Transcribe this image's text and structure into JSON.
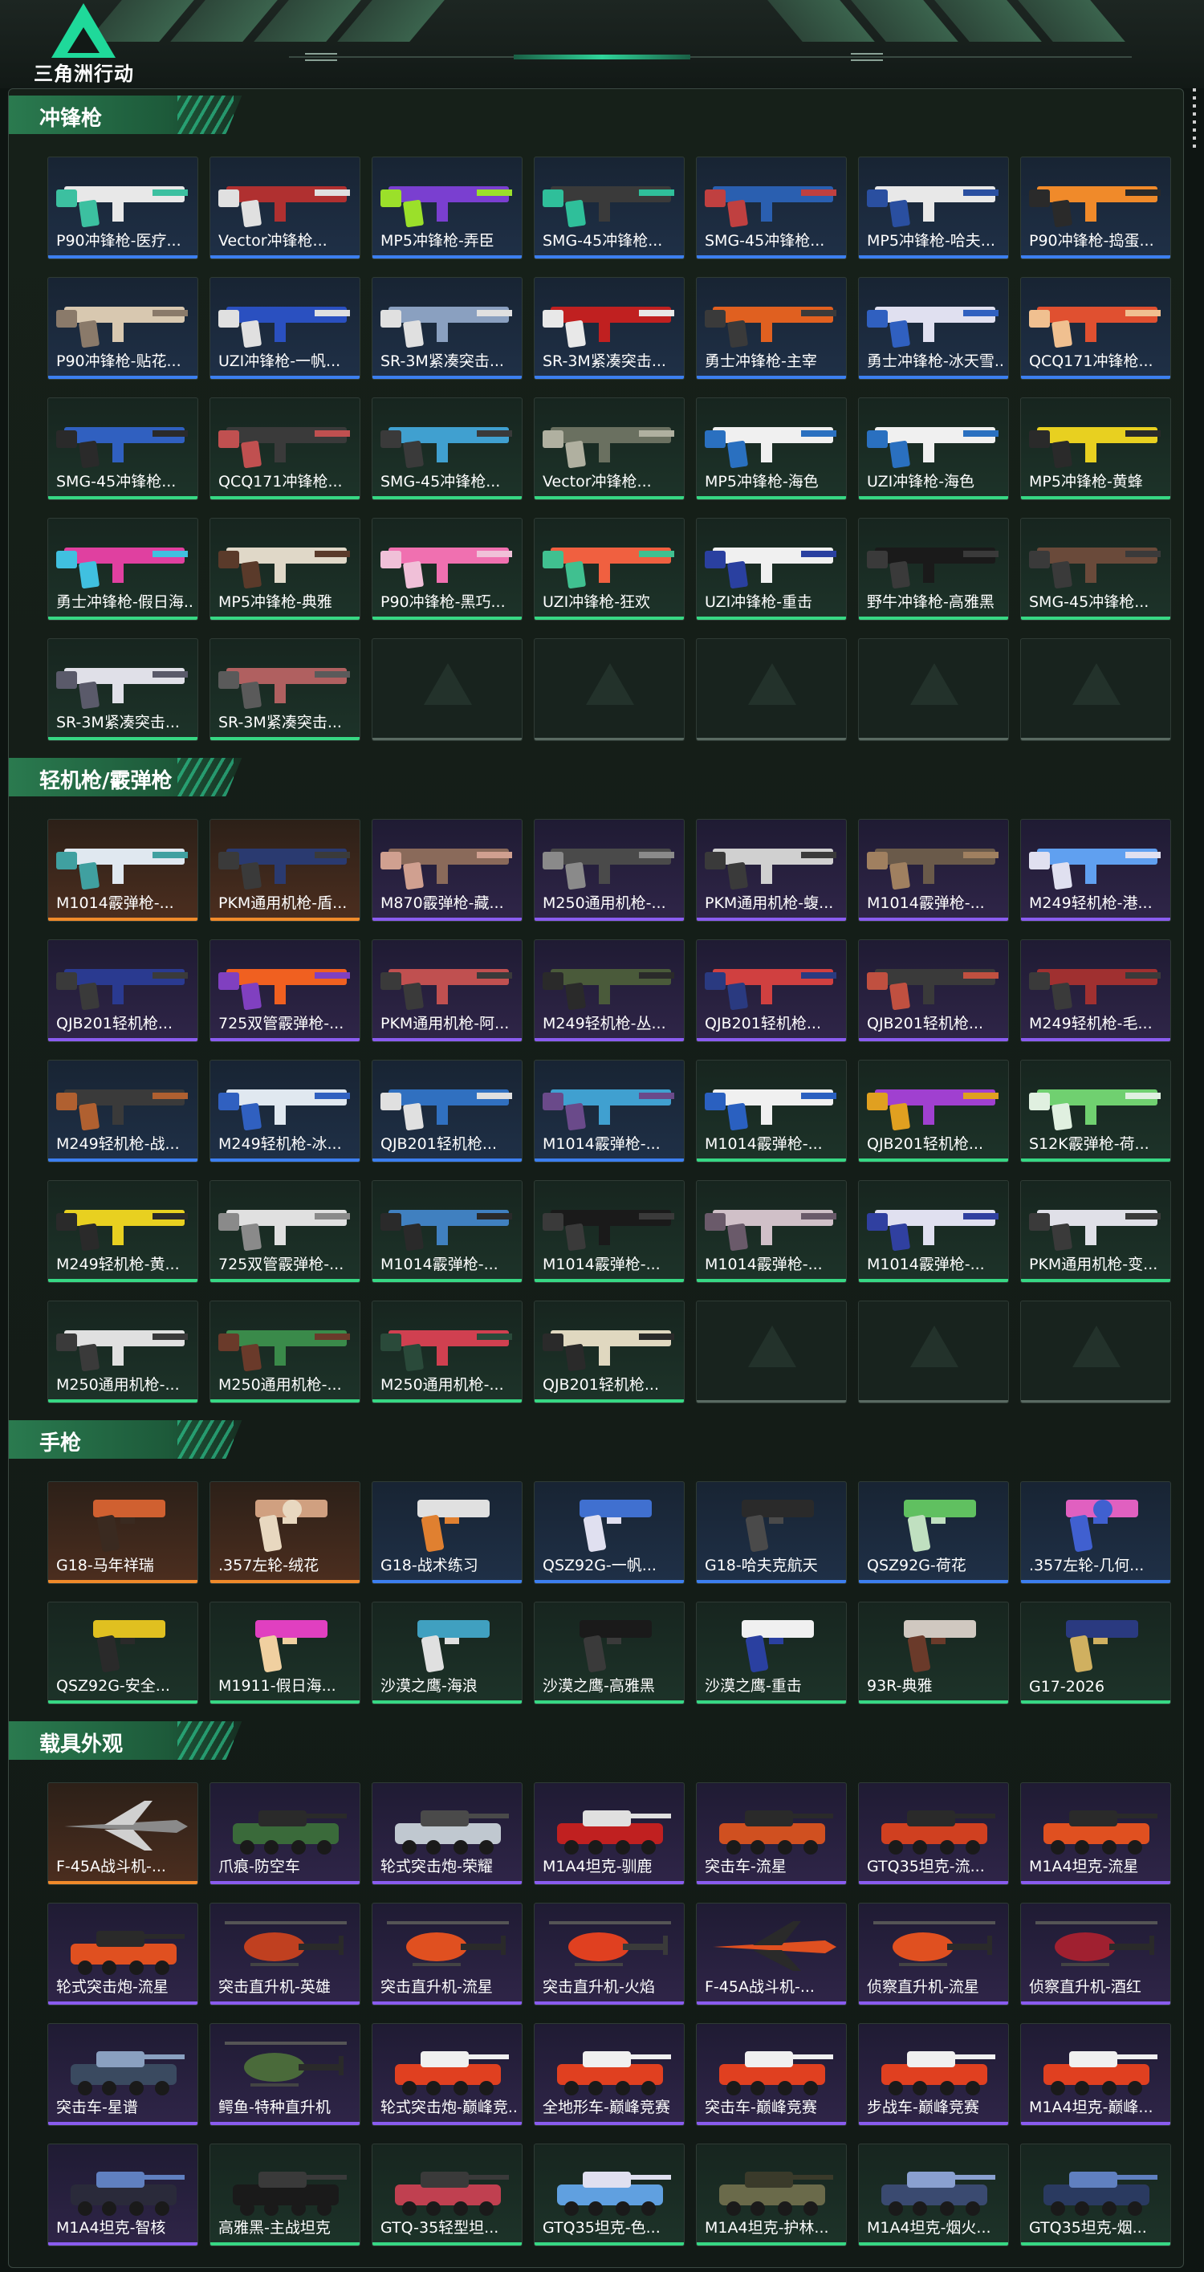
{
  "header": {
    "logo_text": "三角洲行动"
  },
  "colors": {
    "gold": "#f08a2a",
    "purple": "#8a5cf0",
    "blue": "#3c7ff0",
    "green": "#37d884",
    "accent": "#2fd49a"
  },
  "sections": [
    {
      "title": "冲锋枪",
      "items": [
        {
          "label": "P90冲锋枪-医疗...",
          "rarity": "blue",
          "icon": "smg-icon",
          "c1": "#e8e8e8",
          "c2": "#3cc0a0"
        },
        {
          "label": "Vector冲锋枪...",
          "rarity": "blue",
          "icon": "smg-icon",
          "c1": "#b03030",
          "c2": "#e0e0e0"
        },
        {
          "label": "MP5冲锋枪-弄臣",
          "rarity": "blue",
          "icon": "smg-icon",
          "c1": "#7a3fd0",
          "c2": "#9be02a"
        },
        {
          "label": "SMG-45冲锋枪...",
          "rarity": "blue",
          "icon": "smg-icon",
          "c1": "#3a3a3a",
          "c2": "#2fbf9a"
        },
        {
          "label": "SMG-45冲锋枪...",
          "rarity": "blue",
          "icon": "smg-icon",
          "c1": "#2a5fb0",
          "c2": "#c04040"
        },
        {
          "label": "MP5冲锋枪-哈夫...",
          "rarity": "blue",
          "icon": "smg-icon",
          "c1": "#e8e8e8",
          "c2": "#2a4fa0"
        },
        {
          "label": "P90冲锋枪-捣蛋...",
          "rarity": "blue",
          "icon": "smg-icon",
          "c1": "#f08a2a",
          "c2": "#2a2a2a"
        },
        {
          "label": "P90冲锋枪-贴花...",
          "rarity": "blue",
          "icon": "smg-icon",
          "c1": "#d8c8b0",
          "c2": "#8a7a6a"
        },
        {
          "label": "UZI冲锋枪-一帆...",
          "rarity": "blue",
          "icon": "smg-icon",
          "c1": "#2a50c0",
          "c2": "#e0e0e0"
        },
        {
          "label": "SR-3M紧凑突击...",
          "rarity": "blue",
          "icon": "smg-icon",
          "c1": "#8aa0c0",
          "c2": "#e0e0e0"
        },
        {
          "label": "SR-3M紧凑突击...",
          "rarity": "blue",
          "icon": "smg-icon",
          "c1": "#c02020",
          "c2": "#e8e8e8"
        },
        {
          "label": "勇士冲锋枪-主宰",
          "rarity": "blue",
          "icon": "smg-icon",
          "c1": "#e06020",
          "c2": "#3a3a3a"
        },
        {
          "label": "勇士冲锋枪-冰天雪...",
          "rarity": "blue",
          "icon": "smg-icon",
          "c1": "#e0e0f0",
          "c2": "#3060c0"
        },
        {
          "label": "QCQ171冲锋枪...",
          "rarity": "blue",
          "icon": "smg-icon",
          "c1": "#e05030",
          "c2": "#f0c090"
        },
        {
          "label": "SMG-45冲锋枪...",
          "rarity": "green",
          "icon": "smg-icon",
          "c1": "#3060c0",
          "c2": "#2a2a2a"
        },
        {
          "label": "QCQ171冲锋枪...",
          "rarity": "green",
          "icon": "smg-icon",
          "c1": "#3a3a3a",
          "c2": "#c05050"
        },
        {
          "label": "SMG-45冲锋枪...",
          "rarity": "green",
          "icon": "smg-icon",
          "c1": "#40a0d0",
          "c2": "#3a3a3a"
        },
        {
          "label": "Vector冲锋枪...",
          "rarity": "green",
          "icon": "smg-icon",
          "c1": "#6a7060",
          "c2": "#b0b0a0"
        },
        {
          "label": "MP5冲锋枪-海色",
          "rarity": "green",
          "icon": "smg-icon",
          "c1": "#f0f0f0",
          "c2": "#2a70c0"
        },
        {
          "label": "UZI冲锋枪-海色",
          "rarity": "green",
          "icon": "smg-icon",
          "c1": "#f0f0f0",
          "c2": "#2a70c0"
        },
        {
          "label": "MP5冲锋枪-黄蜂",
          "rarity": "green",
          "icon": "smg-icon",
          "c1": "#e8d020",
          "c2": "#2a2a2a"
        },
        {
          "label": "勇士冲锋枪-假日海...",
          "rarity": "green",
          "icon": "smg-icon",
          "c1": "#e040a0",
          "c2": "#40c0e0"
        },
        {
          "label": "MP5冲锋枪-典雅",
          "rarity": "green",
          "icon": "smg-icon",
          "c1": "#e0d8c8",
          "c2": "#5a3a2a"
        },
        {
          "label": "P90冲锋枪-黑巧...",
          "rarity": "green",
          "icon": "smg-icon",
          "c1": "#f070b0",
          "c2": "#f0c0d8"
        },
        {
          "label": "UZI冲锋枪-狂欢",
          "rarity": "green",
          "icon": "smg-icon",
          "c1": "#f06040",
          "c2": "#40c090"
        },
        {
          "label": "UZI冲锋枪-重击",
          "rarity": "green",
          "icon": "smg-icon",
          "c1": "#f0f0f0",
          "c2": "#2a40a0"
        },
        {
          "label": "野牛冲锋枪-高雅黑",
          "rarity": "green",
          "icon": "smg-icon",
          "c1": "#1a1a1a",
          "c2": "#3a3a3a"
        },
        {
          "label": "SMG-45冲锋枪...",
          "rarity": "green",
          "icon": "smg-icon",
          "c1": "#6a4a3a",
          "c2": "#3a3a3a"
        },
        {
          "label": "SR-3M紧凑突击...",
          "rarity": "green",
          "icon": "smg-icon",
          "c1": "#e0e0e8",
          "c2": "#5a5a6a"
        },
        {
          "label": "SR-3M紧凑突击...",
          "rarity": "green",
          "icon": "smg-icon",
          "c1": "#b06060",
          "c2": "#5a5a5a"
        },
        {
          "label": "",
          "rarity": "empty"
        },
        {
          "label": "",
          "rarity": "empty"
        },
        {
          "label": "",
          "rarity": "empty"
        },
        {
          "label": "",
          "rarity": "empty"
        },
        {
          "label": "",
          "rarity": "empty"
        }
      ]
    },
    {
      "title": "轻机枪/霰弹枪",
      "items": [
        {
          "label": "M1014霰弹枪-...",
          "rarity": "gold",
          "icon": "shotgun-icon",
          "c1": "#e0e8f0",
          "c2": "#40a0a0"
        },
        {
          "label": "PKM通用机枪-盾...",
          "rarity": "gold",
          "icon": "lmg-icon",
          "c1": "#2a3a70",
          "c2": "#3a3a3a"
        },
        {
          "label": "M870霰弹枪-藏...",
          "rarity": "purple",
          "icon": "shotgun-icon",
          "c1": "#8a6a5a",
          "c2": "#d0a090"
        },
        {
          "label": "M250通用机枪-...",
          "rarity": "purple",
          "icon": "lmg-icon",
          "c1": "#4a4a4a",
          "c2": "#8a8a8a"
        },
        {
          "label": "PKM通用机枪-蝮...",
          "rarity": "purple",
          "icon": "lmg-icon",
          "c1": "#d0d0d0",
          "c2": "#3a3a3a"
        },
        {
          "label": "M1014霰弹枪-...",
          "rarity": "purple",
          "icon": "shotgun-icon",
          "c1": "#6a5a4a",
          "c2": "#a08060"
        },
        {
          "label": "M249轻机枪-港...",
          "rarity": "purple",
          "icon": "lmg-icon",
          "c1": "#60a0f0",
          "c2": "#e0e0f0"
        },
        {
          "label": "QJB201轻机枪...",
          "rarity": "purple",
          "icon": "lmg-icon",
          "c1": "#2a3a90",
          "c2": "#3a3a3a"
        },
        {
          "label": "725双管霰弹枪-...",
          "rarity": "purple",
          "icon": "shotgun-icon",
          "c1": "#f06020",
          "c2": "#8040c0"
        },
        {
          "label": "PKM通用机枪-阿...",
          "rarity": "purple",
          "icon": "lmg-icon",
          "c1": "#c05050",
          "c2": "#3a3a3a"
        },
        {
          "label": "M249轻机枪-丛...",
          "rarity": "purple",
          "icon": "lmg-icon",
          "c1": "#4a5a3a",
          "c2": "#2a2a2a"
        },
        {
          "label": "QJB201轻机枪...",
          "rarity": "purple",
          "icon": "lmg-icon",
          "c1": "#d04040",
          "c2": "#2a3a80"
        },
        {
          "label": "QJB201轻机枪...",
          "rarity": "purple",
          "icon": "lmg-icon",
          "c1": "#3a3a3a",
          "c2": "#c05040"
        },
        {
          "label": "M249轻机枪-毛...",
          "rarity": "purple",
          "icon": "lmg-icon",
          "c1": "#a03030",
          "c2": "#3a3a3a"
        },
        {
          "label": "M249轻机枪-战...",
          "rarity": "blue",
          "icon": "lmg-icon",
          "c1": "#3a3a3a",
          "c2": "#b06030"
        },
        {
          "label": "M249轻机枪-冰...",
          "rarity": "blue",
          "icon": "lmg-icon",
          "c1": "#e0e8f0",
          "c2": "#3060c0"
        },
        {
          "label": "QJB201轻机枪...",
          "rarity": "blue",
          "icon": "lmg-icon",
          "c1": "#3070c0",
          "c2": "#e0e0e0"
        },
        {
          "label": "M1014霰弹枪-...",
          "rarity": "blue",
          "icon": "shotgun-icon",
          "c1": "#40a0d0",
          "c2": "#6a4a8a"
        },
        {
          "label": "M1014霰弹枪-...",
          "rarity": "green",
          "icon": "shotgun-icon",
          "c1": "#f0f0f0",
          "c2": "#2a60c0"
        },
        {
          "label": "QJB201轻机枪...",
          "rarity": "green",
          "icon": "lmg-icon",
          "c1": "#a040d0",
          "c2": "#e0a020"
        },
        {
          "label": "S12K霰弹枪-荷...",
          "rarity": "green",
          "icon": "shotgun-icon",
          "c1": "#70d070",
          "c2": "#e0f0e0"
        },
        {
          "label": "M249轻机枪-黄...",
          "rarity": "green",
          "icon": "lmg-icon",
          "c1": "#e8d020",
          "c2": "#2a2a2a"
        },
        {
          "label": "725双管霰弹枪-...",
          "rarity": "green",
          "icon": "shotgun-icon",
          "c1": "#e0e0e0",
          "c2": "#8a8a8a"
        },
        {
          "label": "M1014霰弹枪-...",
          "rarity": "green",
          "icon": "shotgun-icon",
          "c1": "#4080c0",
          "c2": "#2a2a2a"
        },
        {
          "label": "M1014霰弹枪-...",
          "rarity": "green",
          "icon": "shotgun-icon",
          "c1": "#1a1a1a",
          "c2": "#3a3a3a"
        },
        {
          "label": "M1014霰弹枪-...",
          "rarity": "green",
          "icon": "shotgun-icon",
          "c1": "#d0c0c8",
          "c2": "#6a5a6a"
        },
        {
          "label": "M1014霰弹枪-...",
          "rarity": "green",
          "icon": "shotgun-icon",
          "c1": "#e0e0f0",
          "c2": "#3040a0"
        },
        {
          "label": "PKM通用机枪-变...",
          "rarity": "green",
          "icon": "lmg-icon",
          "c1": "#e0e0e8",
          "c2": "#3a3a3a"
        },
        {
          "label": "M250通用机枪-...",
          "rarity": "green",
          "icon": "lmg-icon",
          "c1": "#e0e0e0",
          "c2": "#3a3a3a"
        },
        {
          "label": "M250通用机枪-...",
          "rarity": "green",
          "icon": "lmg-icon",
          "c1": "#3a8a4a",
          "c2": "#6a3a2a"
        },
        {
          "label": "M250通用机枪-...",
          "rarity": "green",
          "icon": "lmg-icon",
          "c1": "#d04050",
          "c2": "#2a4a3a"
        },
        {
          "label": "QJB201轻机枪...",
          "rarity": "green",
          "icon": "lmg-icon",
          "c1": "#e0d8c0",
          "c2": "#2a2a2a"
        },
        {
          "label": "",
          "rarity": "empty"
        },
        {
          "label": "",
          "rarity": "empty"
        },
        {
          "label": "",
          "rarity": "empty"
        }
      ]
    },
    {
      "title": "手枪",
      "items": [
        {
          "label": "G18-马年祥瑞",
          "rarity": "gold",
          "icon": "pistol-icon",
          "c1": "#d06030",
          "c2": "#3a2a20"
        },
        {
          "label": ".357左轮-绒花",
          "rarity": "gold",
          "icon": "revolver-icon",
          "c1": "#d0a080",
          "c2": "#e8d8c0"
        },
        {
          "label": "G18-战术练习",
          "rarity": "blue",
          "icon": "pistol-icon",
          "c1": "#e0e0e0",
          "c2": "#e08030"
        },
        {
          "label": "QSZ92G-一帆...",
          "rarity": "blue",
          "icon": "pistol-icon",
          "c1": "#4070d0",
          "c2": "#e0e0f0"
        },
        {
          "label": "G18-哈夫克航天",
          "rarity": "blue",
          "icon": "pistol-icon",
          "c1": "#2a2a2a",
          "c2": "#4a4a4a"
        },
        {
          "label": "QSZ92G-荷花",
          "rarity": "blue",
          "icon": "pistol-icon",
          "c1": "#60c060",
          "c2": "#c0e0c0"
        },
        {
          "label": ".357左轮-几何...",
          "rarity": "blue",
          "icon": "revolver-icon",
          "c1": "#e060c0",
          "c2": "#4060d0"
        },
        {
          "label": "QSZ92G-安全...",
          "rarity": "green",
          "icon": "pistol-icon",
          "c1": "#e0c020",
          "c2": "#2a2a2a"
        },
        {
          "label": "M1911-假日海...",
          "rarity": "green",
          "icon": "pistol-icon",
          "c1": "#e040c0",
          "c2": "#f0d0a0"
        },
        {
          "label": "沙漠之鹰-海浪",
          "rarity": "green",
          "icon": "pistol-icon",
          "c1": "#40a0c0",
          "c2": "#e0e0e0"
        },
        {
          "label": "沙漠之鹰-高雅黑",
          "rarity": "green",
          "icon": "pistol-icon",
          "c1": "#1a1a1a",
          "c2": "#3a3a3a"
        },
        {
          "label": "沙漠之鹰-重击",
          "rarity": "green",
          "icon": "pistol-icon",
          "c1": "#f0f0f0",
          "c2": "#2a40a0"
        },
        {
          "label": "93R-典雅",
          "rarity": "green",
          "icon": "pistol-icon",
          "c1": "#d0c8c0",
          "c2": "#6a3a2a"
        },
        {
          "label": "G17-2026",
          "rarity": "green",
          "icon": "pistol-icon",
          "c1": "#2a3a80",
          "c2": "#d0b060"
        }
      ]
    },
    {
      "title": "载具外观",
      "items": [
        {
          "label": "F-45A战斗机-...",
          "rarity": "gold",
          "icon": "jet-icon",
          "c1": "#8a8a8a",
          "c2": "#d0d0d0"
        },
        {
          "label": "爪痕-防空车",
          "rarity": "purple",
          "icon": "armored-car-icon",
          "c1": "#3a6a3a",
          "c2": "#2a2a2a"
        },
        {
          "label": "轮式突击炮-荣耀",
          "rarity": "purple",
          "icon": "armored-car-icon",
          "c1": "#c0c8d0",
          "c2": "#4a4a4a"
        },
        {
          "label": "M1A4坦克-驯鹿",
          "rarity": "purple",
          "icon": "tank-icon",
          "c1": "#c02020",
          "c2": "#e0e0e0"
        },
        {
          "label": "突击车-流星",
          "rarity": "purple",
          "icon": "buggy-icon",
          "c1": "#d05020",
          "c2": "#2a2a2a"
        },
        {
          "label": "GTQ35坦克-流...",
          "rarity": "purple",
          "icon": "tank-icon",
          "c1": "#d04020",
          "c2": "#2a2a2a"
        },
        {
          "label": "M1A4坦克-流星",
          "rarity": "purple",
          "icon": "tank-icon",
          "c1": "#e05020",
          "c2": "#2a2a2a"
        },
        {
          "label": "轮式突击炮-流星",
          "rarity": "purple",
          "icon": "armored-car-icon",
          "c1": "#e05020",
          "c2": "#2a2a2a"
        },
        {
          "label": "突击直升机-英雄",
          "rarity": "purple",
          "icon": "helicopter-icon",
          "c1": "#c04020",
          "c2": "#2a2a2a"
        },
        {
          "label": "突击直升机-流星",
          "rarity": "purple",
          "icon": "helicopter-icon",
          "c1": "#e05020",
          "c2": "#2a2a2a"
        },
        {
          "label": "突击直升机-火焰",
          "rarity": "purple",
          "icon": "helicopter-icon",
          "c1": "#e04020",
          "c2": "#3a3a3a"
        },
        {
          "label": "F-45A战斗机-...",
          "rarity": "purple",
          "icon": "jet-icon",
          "c1": "#e05020",
          "c2": "#2a2a2a"
        },
        {
          "label": "侦察直升机-流星",
          "rarity": "purple",
          "icon": "helicopter-icon",
          "c1": "#e05020",
          "c2": "#2a2a2a"
        },
        {
          "label": "侦察直升机-酒红",
          "rarity": "purple",
          "icon": "helicopter-icon",
          "c1": "#a02030",
          "c2": "#2a2a2a"
        },
        {
          "label": "突击车-星谱",
          "rarity": "purple",
          "icon": "buggy-icon",
          "c1": "#3a4a60",
          "c2": "#8aa0c0"
        },
        {
          "label": "鳄鱼-特种直升机",
          "rarity": "purple",
          "icon": "helicopter-icon",
          "c1": "#4a6a3a",
          "c2": "#2a2a2a"
        },
        {
          "label": "轮式突击炮-巅峰竞...",
          "rarity": "purple",
          "icon": "armored-car-icon",
          "c1": "#e04020",
          "c2": "#f0f0f0"
        },
        {
          "label": "全地形车-巅峰竞赛",
          "rarity": "purple",
          "icon": "atv-icon",
          "c1": "#e04020",
          "c2": "#f0f0f0"
        },
        {
          "label": "突击车-巅峰竞赛",
          "rarity": "purple",
          "icon": "buggy-icon",
          "c1": "#e04020",
          "c2": "#f0f0f0"
        },
        {
          "label": "步战车-巅峰竞赛",
          "rarity": "purple",
          "icon": "armored-car-icon",
          "c1": "#e04020",
          "c2": "#f0f0f0"
        },
        {
          "label": "M1A4坦克-巅峰...",
          "rarity": "purple",
          "icon": "tank-icon",
          "c1": "#e04020",
          "c2": "#f0f0f0"
        },
        {
          "label": "M1A4坦克-智核",
          "rarity": "purple",
          "icon": "tank-icon",
          "c1": "#2a2a3a",
          "c2": "#6080c0"
        },
        {
          "label": "高雅黑-主战坦克",
          "rarity": "green",
          "icon": "tank-icon",
          "c1": "#1a1a1a",
          "c2": "#3a3a3a"
        },
        {
          "label": "GTQ-35轻型坦...",
          "rarity": "green",
          "icon": "tank-icon",
          "c1": "#c04050",
          "c2": "#3a3a3a"
        },
        {
          "label": "GTQ35坦克-色...",
          "rarity": "green",
          "icon": "tank-icon",
          "c1": "#60a0e0",
          "c2": "#e0e0f0"
        },
        {
          "label": "M1A4坦克-护林...",
          "rarity": "green",
          "icon": "tank-icon",
          "c1": "#6a6a4a",
          "c2": "#3a3a2a"
        },
        {
          "label": "M1A4坦克-烟火...",
          "rarity": "green",
          "icon": "tank-icon",
          "c1": "#3a4a70",
          "c2": "#8aa0d0"
        },
        {
          "label": "GTQ35坦克-烟...",
          "rarity": "green",
          "icon": "tank-icon",
          "c1": "#2a3a60",
          "c2": "#6080c0"
        }
      ]
    }
  ]
}
